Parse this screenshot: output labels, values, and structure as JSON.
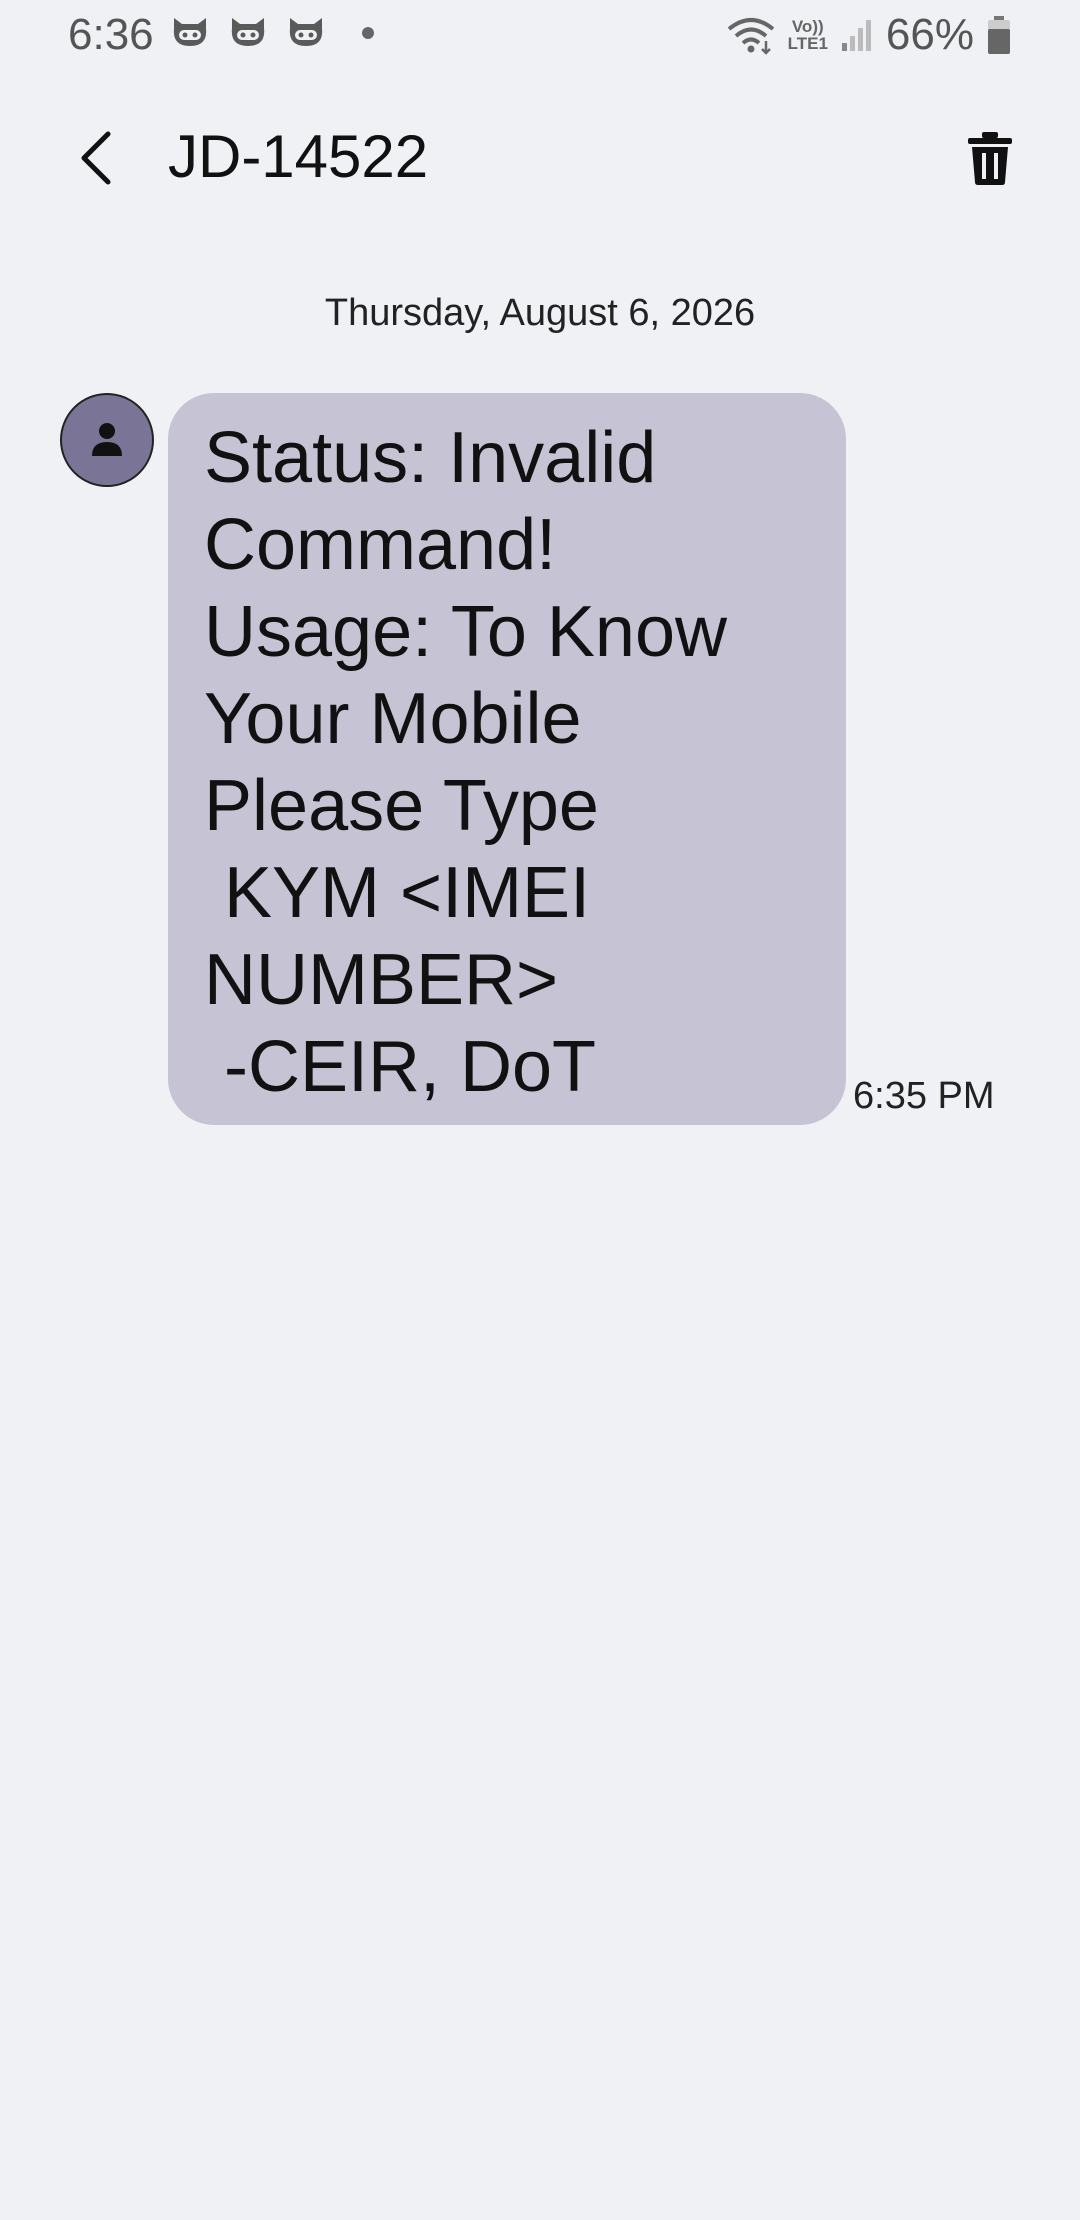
{
  "status_bar": {
    "time": "6:36",
    "battery_percent": "66%",
    "network_top": "Vo))",
    "network_bottom": "LTE1",
    "icons": [
      "cat-notification-icon",
      "cat-notification-icon",
      "cat-notification-icon",
      "more-notifications-dot",
      "wifi-icon",
      "signal-icon",
      "battery-icon"
    ]
  },
  "header": {
    "contact": "JD-14522",
    "back_icon": "back-arrow-icon",
    "delete_icon": "trash-icon"
  },
  "conversation": {
    "date": "Thursday, August 6, 2026",
    "messages": [
      {
        "text": "Status: Invalid\nCommand!\nUsage: To Know\nYour Mobile\nPlease Type\n KYM <IMEI\nNUMBER>\n -CEIR, DoT",
        "time": "6:35 PM",
        "direction": "incoming"
      }
    ]
  },
  "colors": {
    "background": "#f0f1f5",
    "bubble": "#c6c4d4",
    "avatar": "#7a7596"
  }
}
